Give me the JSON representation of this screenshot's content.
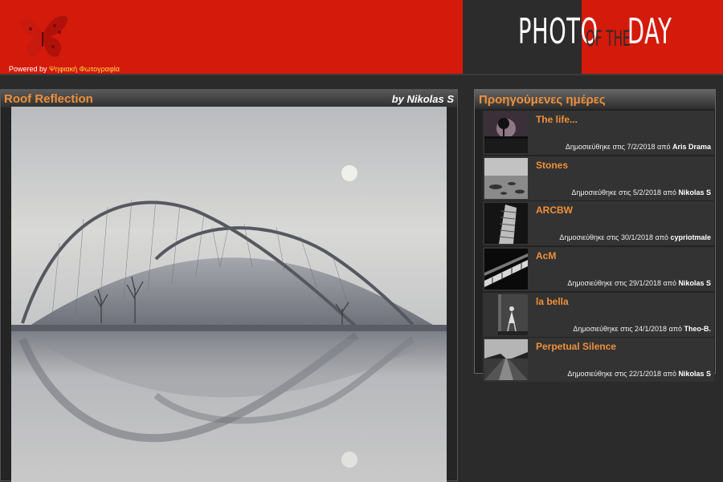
{
  "header": {
    "powered_prefix": "Powered by",
    "powered_brand": "Ψηφιακή Φωτογραφία",
    "logo_word_photo": "PHOTO",
    "logo_word_ofthe": "OF THE",
    "logo_word_day": "DAY",
    "brand_red": "#d41a0b"
  },
  "photo": {
    "title": "Roof Reflection",
    "author": "by Nikolas S"
  },
  "sidebar": {
    "title": "Προηγούμενες ημέρες",
    "items": [
      {
        "title": "The life...",
        "meta_prefix": "Δημοσιεύθηκε στις 7/2/2018 από",
        "author": "Aris Drama"
      },
      {
        "title": "Stones",
        "meta_prefix": "Δημοσιεύθηκε στις 5/2/2018 από",
        "author": "Nikolas S"
      },
      {
        "title": "ARCBW",
        "meta_prefix": "Δημοσιεύθηκε στις 30/1/2018 από",
        "author": "cypriotmale"
      },
      {
        "title": "AcM",
        "meta_prefix": "Δημοσιεύθηκε στις 29/1/2018 από",
        "author": "Nikolas S"
      },
      {
        "title": "la bella",
        "meta_prefix": "Δημοσιεύθηκε στις 24/1/2018 από",
        "author": "Theo-B."
      },
      {
        "title": "Perpetual Silence",
        "meta_prefix": "Δημοσιεύθηκε στις 22/1/2018 από",
        "author": "Nikolas S"
      }
    ]
  }
}
